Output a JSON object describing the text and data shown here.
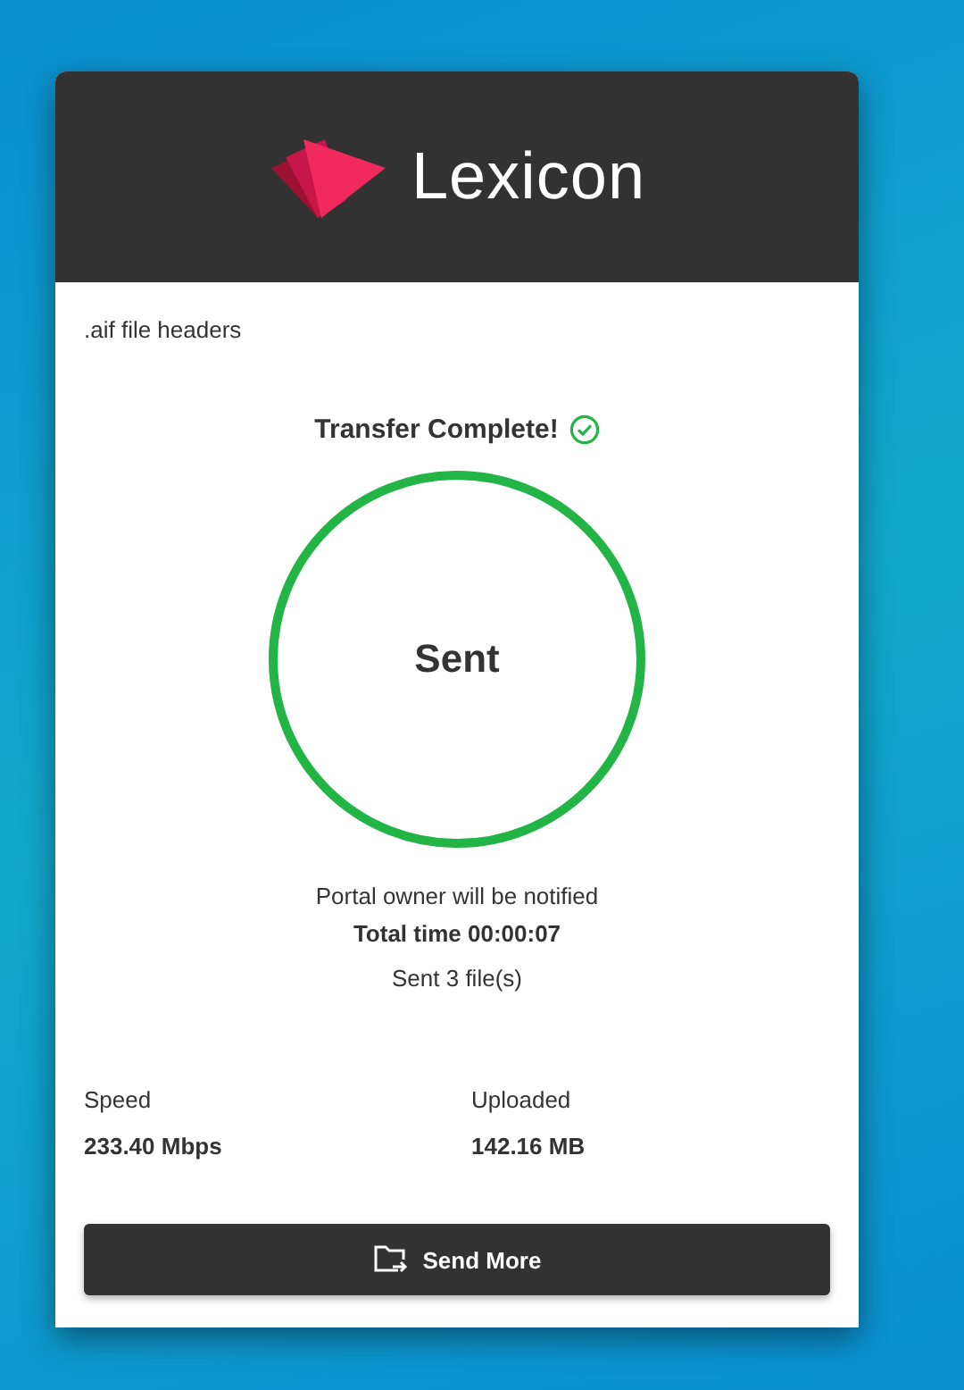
{
  "header": {
    "logo_text": "Lexicon"
  },
  "file_name": ".aif file headers",
  "status": {
    "title": "Transfer Complete!",
    "complete": true
  },
  "progress": {
    "level": 1,
    "label": "Sent"
  },
  "messages": [
    "Portal owner will be notified",
    "Total time 00:00:07",
    "Sent 3 file(s)"
  ],
  "stats": [
    {
      "label": "Speed",
      "value": "233.40 Mbps"
    },
    {
      "label": "Uploaded",
      "value": "142.16 MB"
    }
  ],
  "button": {
    "label": "Send More"
  }
}
